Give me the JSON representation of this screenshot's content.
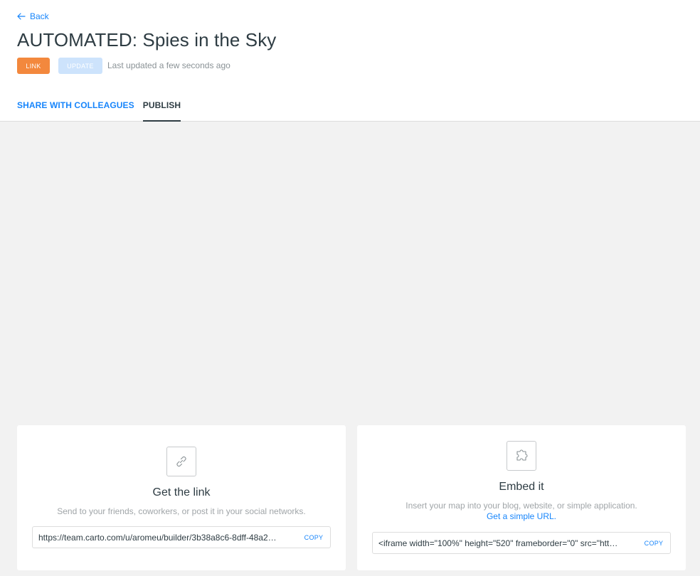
{
  "header": {
    "back_label": "Back",
    "title": "AUTOMATED: Spies in the Sky",
    "link_button": "LINK",
    "update_button": "UPDATE",
    "last_updated": "Last updated a few seconds ago"
  },
  "tabs": [
    {
      "label": "SHARE WITH COLLEAGUES",
      "active": false
    },
    {
      "label": "PUBLISH",
      "active": true
    }
  ],
  "cards": {
    "link": {
      "icon": "link-icon",
      "title": "Get the link",
      "description": "Send to your friends, coworkers, or post it in your social networks.",
      "field_value": "https://team.carto.com/u/aromeu/builder/3b38a8c6-8dff-48a2…",
      "copy_label": "COPY"
    },
    "embed": {
      "icon": "puzzle-icon",
      "title": "Embed it",
      "description": "Insert your map into your blog, website, or simple application.",
      "sublink": "Get a simple URL.",
      "field_value": "<iframe width=\"100%\" height=\"520\" frameborder=\"0\" src=\"htt…",
      "copy_label": "COPY"
    }
  },
  "colors": {
    "accent": "#1785FB",
    "link_button": "#F3883D",
    "update_button": "#CDE3FC",
    "background": "#F2F2F2"
  }
}
